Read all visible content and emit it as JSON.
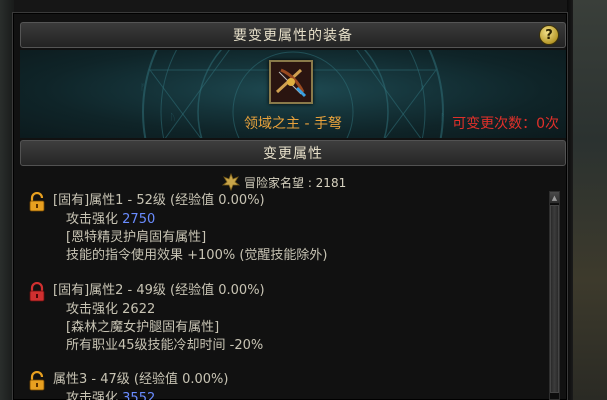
{
  "window": {
    "title": "要变更属性的装备",
    "help_label": "?"
  },
  "item": {
    "name": "领域之主 - 手弩",
    "change_count": "可变更次数：0次"
  },
  "section": {
    "title": "变更属性"
  },
  "fame": {
    "text": "冒险家名望 : 2181"
  },
  "attributes": [
    {
      "locked": false,
      "header": "[固有]属性1 - 52级 (经验值 0.00%)",
      "stat_label": "攻击强化",
      "stat_value": "2750",
      "stat_highlight": true,
      "source": "[恩特精灵护肩固有属性]",
      "effect": "技能的指令使用效果 +100% (觉醒技能除外)"
    },
    {
      "locked": true,
      "header": "[固有]属性2 - 49级 (经验值 0.00%)",
      "stat_label": "攻击强化",
      "stat_value": "2622",
      "stat_highlight": false,
      "source": "[森林之魔女护腿固有属性]",
      "effect": "所有职业45级技能冷却时间 -20%"
    },
    {
      "locked": false,
      "header": "属性3 - 47级 (经验值 0.00%)",
      "stat_label": "攻击强化",
      "stat_value": "3552",
      "stat_highlight": true,
      "source": "",
      "effect": ""
    }
  ],
  "colors": {
    "item_name": "#e8a23c",
    "change_count": "#e0302a",
    "lock_open": "#e8a020",
    "lock_closed": "#d03030",
    "highlight_value": "#6a8cff"
  },
  "icons": {
    "help": "help-icon",
    "fame": "fame-crest-icon",
    "lock_open": "unlocked-icon",
    "lock_closed": "locked-icon",
    "item": "crossbow-icon"
  }
}
